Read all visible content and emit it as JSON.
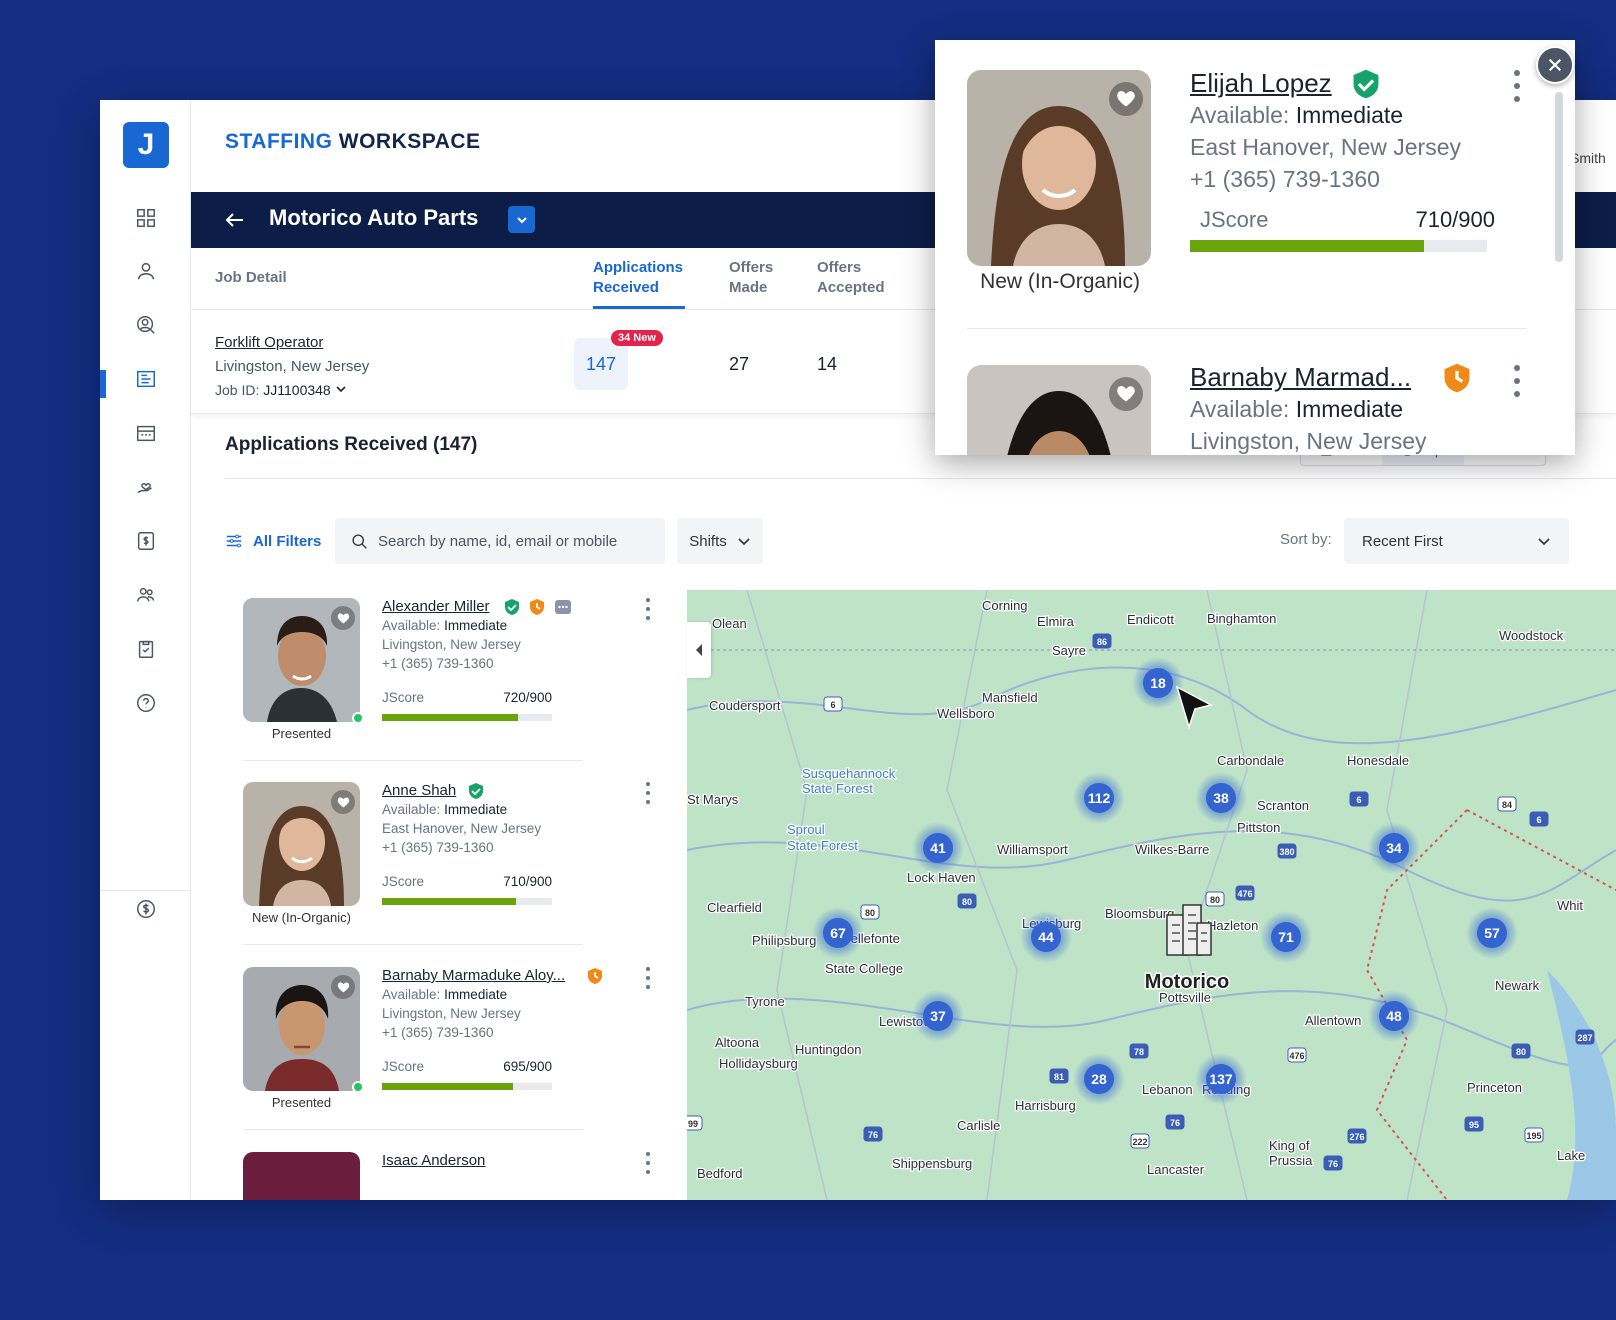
{
  "brand": {
    "part1": "STAFFING",
    "part2": "WORKSPACE",
    "logo_letter": "J"
  },
  "user": {
    "name_fragment": "Smith"
  },
  "job_header": {
    "title": "Motorico Auto Parts"
  },
  "tabs": [
    {
      "label1": "Job Detail",
      "label2": ""
    },
    {
      "label1": "Applications",
      "label2": "Received"
    },
    {
      "label1": "Offers",
      "label2": "Made"
    },
    {
      "label1": "Offers",
      "label2": "Accepted"
    }
  ],
  "job": {
    "name": "Forklift Operator",
    "location": "Livingston, New Jersey",
    "id_label": "Job ID:",
    "id_value": "JJ1100348",
    "applications": "147",
    "new_badge": "34 New",
    "offers_made": "27",
    "offers_accepted": "14"
  },
  "section": {
    "title": "Applications Received (147)"
  },
  "view_toggle": {
    "grid": "Grid",
    "map": "Map",
    "list": "List"
  },
  "filters": {
    "all_filters": "All Filters",
    "search_placeholder": "Search by name, id, email or mobile",
    "shifts": "Shifts",
    "sort_label": "Sort by:",
    "sort_value": "Recent First"
  },
  "candidates": [
    {
      "name": "Alexander Miller",
      "avail_label": "Available:",
      "avail": "Immediate",
      "location": "Livingston, New Jersey",
      "phone": "+1 (365) 739-1360",
      "jscore_label": "JScore",
      "jscore": "720/900",
      "score": 720,
      "status": "Presented"
    },
    {
      "name": "Anne Shah",
      "avail_label": "Available:",
      "avail": "Immediate",
      "location": "East Hanover, New Jersey",
      "phone": "+1 (365) 739-1360",
      "jscore_label": "JScore",
      "jscore": "710/900",
      "score": 710,
      "status": "New (In-Organic)"
    },
    {
      "name": "Barnaby Marmaduke Aloy...",
      "avail_label": "Available:",
      "avail": "Immediate",
      "location": "Livingston, New Jersey",
      "phone": "+1 (365) 739-1360",
      "jscore_label": "JScore",
      "jscore": "695/900",
      "score": 695,
      "status": "Presented"
    },
    {
      "name": "Isaac Anderson"
    }
  ],
  "map": {
    "destination": "Motorico",
    "places": [
      "Corning",
      "Elmira",
      "Endicott",
      "Binghamton",
      "Woodstock",
      "Olean",
      "Sayre",
      "Coudersport",
      "Mansfield",
      "Wellsboro",
      "Carbondale",
      "Honesdale",
      "Susquehannock",
      "State Forest",
      "St Marys",
      "Scranton",
      "Pittston",
      "Sproul",
      "State Forest",
      "Williamsport",
      "Wilkes-Barre",
      "Lock Haven",
      "Clearfield",
      "Bloomsburg",
      "Hazleton",
      "Philipsburg",
      "Bellefonte",
      "Lewisburg",
      "Whit",
      "State College",
      "Pottsville",
      "Newark",
      "Tyrone",
      "Allentown",
      "Lewistown",
      "Altoona",
      "Huntingdon",
      "Hollidaysburg",
      "Princeton",
      "Harrisburg",
      "Lebanon",
      "Reading",
      "Carlisle",
      "King of",
      "Prussia",
      "Lake",
      "Lancaster",
      "Shippensburg",
      "Bedford"
    ],
    "clusters": [
      "18",
      "112",
      "38",
      "34",
      "41",
      "67",
      "44",
      "71",
      "57",
      "37",
      "48",
      "28",
      "137"
    ],
    "route_shields": [
      "6",
      "86",
      "6",
      "84",
      "6",
      "380",
      "80",
      "476",
      "80",
      "80",
      "81",
      "78",
      "476",
      "287",
      "80",
      "99",
      "76",
      "76",
      "222",
      "276",
      "95",
      "195",
      "76"
    ]
  },
  "popup": {
    "candidates": [
      {
        "name": "Elijah Lopez",
        "avail_label": "Available:",
        "avail": "Immediate",
        "location": "East Hanover, New Jersey",
        "phone": "+1 (365) 739-1360",
        "jscore_label": "JScore",
        "jscore": "710/900",
        "score": 710,
        "status": "New (In-Organic)"
      },
      {
        "name": "Barnaby Marmad...",
        "avail_label": "Available:",
        "avail": "Immediate",
        "location": "Livingston, New Jersey"
      }
    ]
  },
  "colors": {
    "brand_blue": "#1967d2",
    "navy": "#0c1d47",
    "jscore_bar": "#6aa40d",
    "new_badge": "#e3234b",
    "online": "#22c55e",
    "verified": "#15a36b",
    "warning": "#f08a16"
  },
  "icons": [
    "grid-icon",
    "user-icon",
    "search-user-icon",
    "jobs-icon",
    "calendar-icon",
    "hand-heart-icon",
    "dollar-icon",
    "team-icon",
    "clipboard-icon",
    "help-icon",
    "coin-icon",
    "heart-icon",
    "shield-check-icon",
    "shield-clock-icon",
    "chat-icon",
    "close-icon",
    "chevron-down-icon",
    "back-arrow-icon",
    "filter-icon",
    "search-icon",
    "building-icon",
    "cursor-icon"
  ]
}
